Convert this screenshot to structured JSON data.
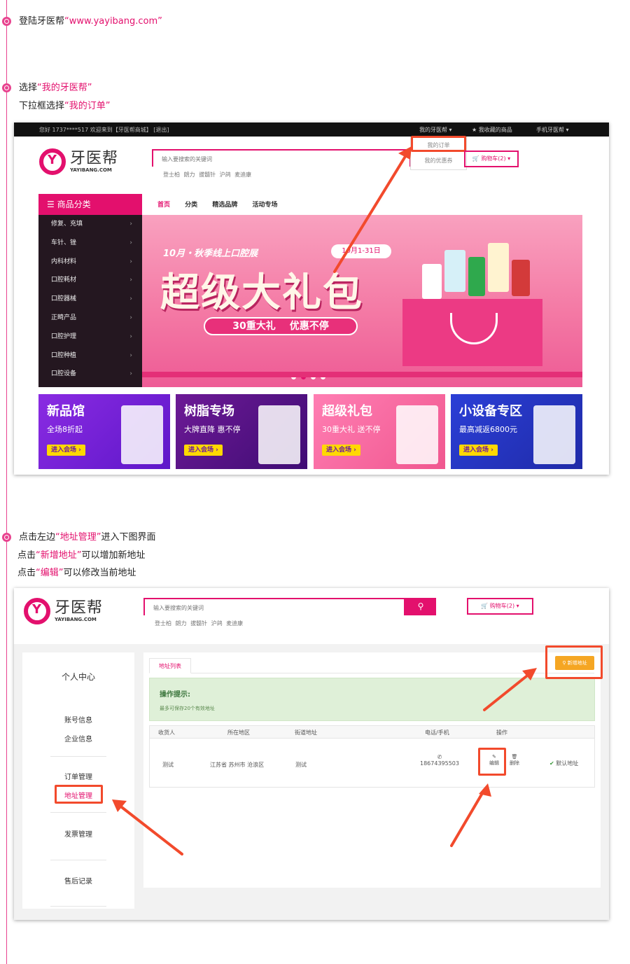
{
  "steps": {
    "s1_pre": "登陆牙医帮",
    "s1_link": "“www.yayibang.com”",
    "s2_pre": "选择",
    "s2_hl": "“我的牙医帮”",
    "s3_pre": "下拉框选择",
    "s3_hl": "“我的订单”",
    "s4_pre": "点击左边",
    "s4_hl": "“地址管理”",
    "s4_post": "进入下图界面",
    "s5_pre": "点击",
    "s5_hl": "“新增地址”",
    "s5_post": "可以增加新地址",
    "s6_pre": "点击",
    "s6_hl": "“编辑”",
    "s6_post": "可以修改当前地址"
  },
  "shot1": {
    "topbar": {
      "left": "您好  1737****517  欢迎来到【牙医帮商城】  [退出]",
      "my_yayibang": "我的牙医帮 ▾",
      "favorites": "★ 我收藏的商品",
      "mobile": "手机牙医帮 ▾"
    },
    "logo_cn": "牙医帮",
    "logo_en": "YAYIBANG.COM",
    "search_placeholder": "输入要搜索的关键词",
    "hot_words": "登士柏 朗力 拔髓针 沪鸽 麦迪康",
    "dropdown": {
      "orders": "我的订单",
      "coupons": "我的优惠券"
    },
    "cart": "购物车(2) ▾",
    "category_title": "☰ 商品分类",
    "categories": [
      "修复、充填",
      "车针、锉",
      "内科材料",
      "口腔耗材",
      "口腔器械",
      "正畸产品",
      "口腔护理",
      "口腔种植",
      "口腔设备"
    ],
    "nav": [
      "首页",
      "分类",
      "精选品牌",
      "活动专场"
    ],
    "banner": {
      "subtitle": "10月・秋季线上口腔展",
      "date": "10月1-31日",
      "headline": "超级大礼包",
      "pill_a": "30重大礼",
      "pill_b": "优惠不停"
    },
    "promos": [
      {
        "title": "新品馆",
        "sub": "全场8折起",
        "btn": "进入会场 ›"
      },
      {
        "title": "树脂专场",
        "sub": "大牌直降 惠不停",
        "btn": "进入会场 ›"
      },
      {
        "title": "超级礼包",
        "sub": "30重大礼 送不停",
        "btn": "进入会场 ›"
      },
      {
        "title": "小设备专区",
        "sub": "最高减返6800元",
        "btn": "进入会场 ›"
      }
    ]
  },
  "shot2": {
    "logo_cn": "牙医帮",
    "logo_en": "YAYIBANG.COM",
    "search_placeholder": "输入要搜索的关键词",
    "hot_words": "登士柏 朗力 拔髓针 沪鸽 麦迪康",
    "cart": "购物车(2) ▾",
    "sidebar": {
      "title": "个人中心",
      "account": "账号信息",
      "company": "企业信息",
      "orders": "订单管理",
      "address": "地址管理",
      "invoice": "发票管理",
      "aftersale": "售后记录"
    },
    "tab": "地址列表",
    "add_button": "⚲ 新增地址",
    "tip_title": "操作提示:",
    "tip_text": "最多可保存20个有效地址",
    "table": {
      "headers": [
        "收货人",
        "所在地区",
        "街道地址",
        "电话/手机",
        "操作"
      ],
      "row": {
        "name": "测试",
        "region": "江苏省 苏州市 沧浪区",
        "street": "测试",
        "phone": "18674395503",
        "edit": "编辑",
        "delete": "删除",
        "default": "默认地址"
      }
    }
  },
  "colors": {
    "brand": "#e3106d",
    "annotation": "#f24a2c",
    "tip_bg": "#dff0d8",
    "add_btn": "#f5a623"
  }
}
